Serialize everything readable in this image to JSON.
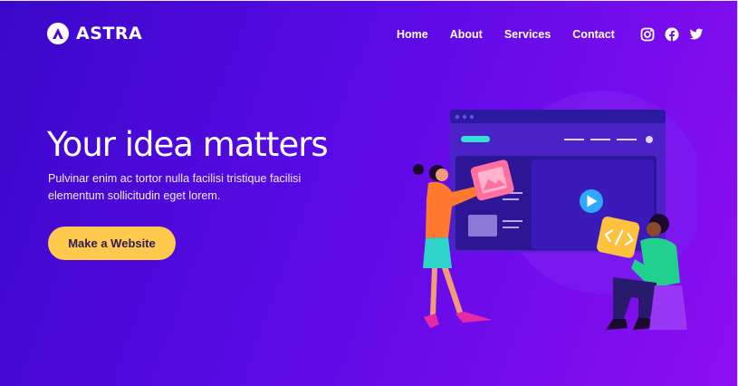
{
  "brand": {
    "name": "ASTRA"
  },
  "nav": {
    "items": [
      "Home",
      "About",
      "Services",
      "Contact"
    ]
  },
  "social": [
    "instagram-icon",
    "facebook-icon",
    "twitter-icon"
  ],
  "hero": {
    "headline": "Your idea matters",
    "subtext": "Pulvinar enim ac tortor nulla facilisi tristique facilisi elementum sollicitudin eget lorem.",
    "cta_label": "Make a Website"
  },
  "colors": {
    "gradient_start": "#3a08c9",
    "gradient_end": "#8d0ef0",
    "cta_background": "#ffc94d",
    "text": "#ffffff"
  }
}
